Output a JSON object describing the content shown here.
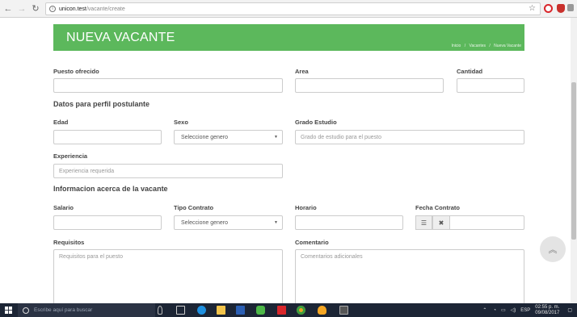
{
  "browser": {
    "url_host": "unicon.test",
    "url_path": "/vacante/create"
  },
  "header": {
    "title": "NUEVA VACANTE",
    "breadcrumb": [
      "Inicio",
      "/",
      "Vacantes",
      "/",
      "Nueva Vacante"
    ]
  },
  "form": {
    "puesto_label": "Puesto ofrecido",
    "area_label": "Area",
    "cantidad_label": "Cantidad",
    "section_perfil": "Datos para perfil postulante",
    "edad_label": "Edad",
    "sexo_label": "Sexo",
    "sexo_value": "Seleccione genero",
    "grado_label": "Grado Estudio",
    "grado_placeholder": "Grado de estudio para el puesto",
    "experiencia_label": "Experiencia",
    "experiencia_placeholder": "Experiencia requerida",
    "section_info": "Informacion acerca de la vacante",
    "salario_label": "Salario",
    "tipo_contrato_label": "Tipo Contrato",
    "tipo_contrato_value": "Seleccione genero",
    "horario_label": "Horario",
    "fecha_contrato_label": "Fecha Contrato",
    "requisitos_label": "Requisitos",
    "requisitos_placeholder": "Requisitos para el puesto",
    "comentario_label": "Comentario",
    "comentario_placeholder": "Comentarios adicionales"
  },
  "taskbar": {
    "search_placeholder": "Escribe aquí para buscar",
    "language": "ESP",
    "time": "02:55 p. m.",
    "date": "09/08/2017"
  },
  "colors": {
    "header_green": "#5cb85c",
    "taskbar": "#1c2535"
  }
}
